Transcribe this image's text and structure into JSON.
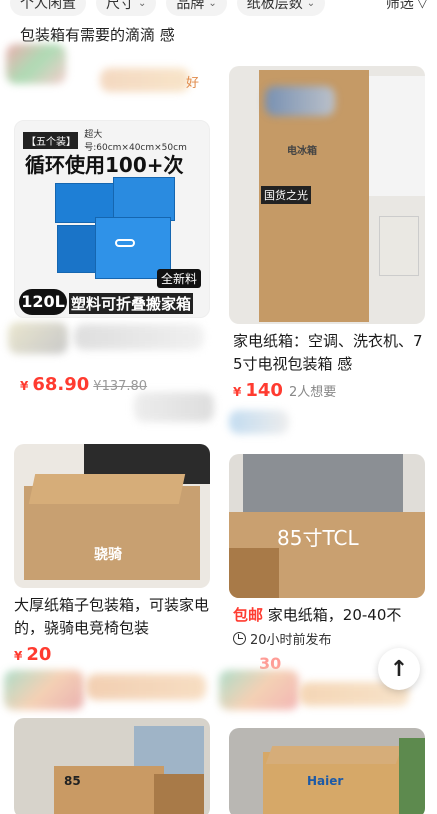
{
  "filters": [
    {
      "label": "个人闲置",
      "has_chevron": false
    },
    {
      "label": "尺寸",
      "has_chevron": true
    },
    {
      "label": "品牌",
      "has_chevron": true
    },
    {
      "label": "纸板层数",
      "has_chevron": true
    },
    {
      "label": "筛选",
      "icon": "filter-icon"
    }
  ],
  "top_snippet": "包装箱有需要的滴滴 感",
  "top_snippet_tail": "好",
  "items": [
    {
      "id": "card-1",
      "image_text": {
        "badge": "【五个装】",
        "size": "超大号:60cm×40cm×50cm",
        "headline": "循环使用100+次",
        "new_tag": "全新料",
        "volume": "120L",
        "caption": "塑料可折叠搬家箱"
      },
      "title": "",
      "price_symbol": "¥",
      "price": "68.90",
      "original_price": "¥137.80"
    },
    {
      "id": "card-2",
      "image_text": {
        "box_label": "电冰箱",
        "sticker": "国货之光"
      },
      "title": "家电纸箱：空调、洗衣机、75寸电视包装箱 感",
      "price_symbol": "¥",
      "price": "140",
      "wants": "2人想要"
    },
    {
      "id": "card-3",
      "image_text": {
        "brand": "骁骑"
      },
      "title": "大厚纸箱子包装箱，可装家电的，骁骑电竞椅包装",
      "price_symbol": "¥",
      "price": "20"
    },
    {
      "id": "card-4",
      "image_text": {
        "box_label": "85寸TCL"
      },
      "tag": "包邮",
      "title": "家电纸箱，20-40不",
      "time": "20小时前发布",
      "price_partial": "30"
    },
    {
      "id": "card-5",
      "image_text": {
        "box_label": "85"
      }
    },
    {
      "id": "card-6",
      "image_text": {
        "box_label": "Haier"
      }
    }
  ],
  "scroll_top": {
    "icon": "arrow-up-icon",
    "glyph": "↑"
  },
  "colors": {
    "price_red": "#ff3b30",
    "chip_bg": "#f3f3f3"
  }
}
